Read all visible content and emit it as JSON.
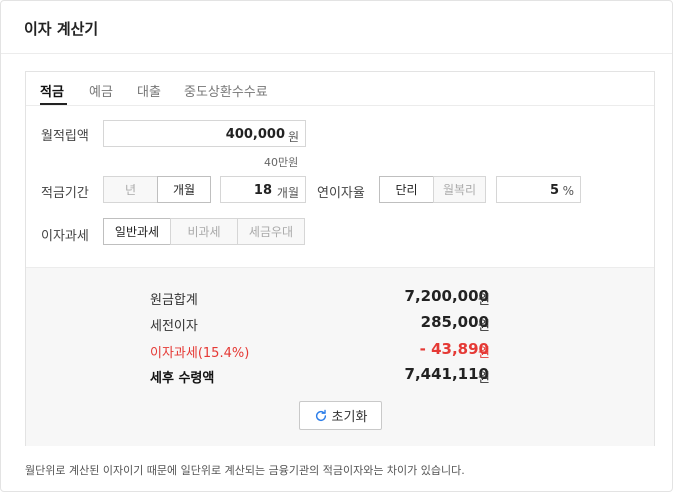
{
  "title": "이자 계산기",
  "tabs": [
    {
      "label": "적금",
      "active": true
    },
    {
      "label": "예금",
      "active": false
    },
    {
      "label": "대출",
      "active": false
    },
    {
      "label": "중도상환수수료",
      "active": false
    }
  ],
  "monthly": {
    "label": "월적립액",
    "value": "400,000",
    "unit": "원",
    "hint": "40만원"
  },
  "period": {
    "label": "적금기간",
    "options": [
      "년",
      "개월"
    ],
    "selected": "개월",
    "value": "18",
    "unit": "개월"
  },
  "rate": {
    "label": "연이자율",
    "options": [
      "단리",
      "월복리"
    ],
    "selected": "단리",
    "value": "5",
    "unit": "%"
  },
  "tax": {
    "label": "이자과세",
    "options": [
      "일반과세",
      "비과세",
      "세금우대"
    ],
    "selected": "일반과세"
  },
  "results": {
    "principal": {
      "label": "원금합계",
      "value": "7,200,000",
      "unit": "원"
    },
    "pretax": {
      "label": "세전이자",
      "value": "285,000",
      "unit": "원"
    },
    "tax": {
      "label": "이자과세(15.4%)",
      "value": "- 43,890",
      "unit": "원"
    },
    "net": {
      "label": "세후 수령액",
      "value": "7,441,110",
      "unit": "원"
    }
  },
  "reset_label": "초기화",
  "note": "월단위로 계산된 이자이기 때문에 일단위로 계산되는 금융기관의 적금이자와는 차이가 있습니다.",
  "colors": {
    "accent_red": "#e53935",
    "icon_blue": "#2b7de9"
  }
}
